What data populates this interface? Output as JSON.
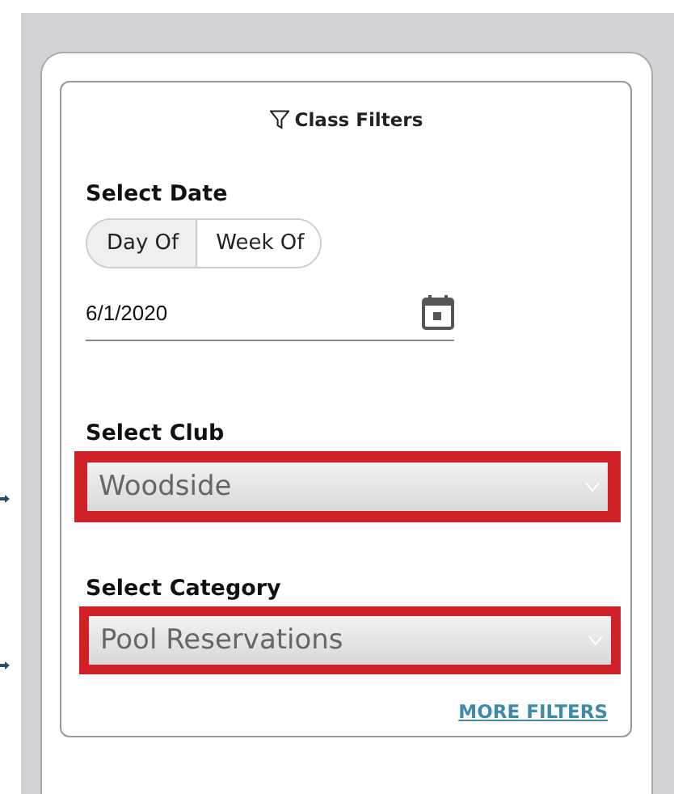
{
  "panel": {
    "title": "Class Filters",
    "date": {
      "label": "Select Date",
      "modes": [
        {
          "label": "Day Of",
          "selected": true
        },
        {
          "label": "Week Of",
          "selected": false
        }
      ],
      "value": "6/1/2020"
    },
    "selects": [
      {
        "label": "Select Club",
        "value": "Woodside",
        "highlighted": true
      },
      {
        "label": "Select Category",
        "value": "Pool Reservations",
        "highlighted": true
      }
    ],
    "more_filters": "MORE FILTERS"
  }
}
